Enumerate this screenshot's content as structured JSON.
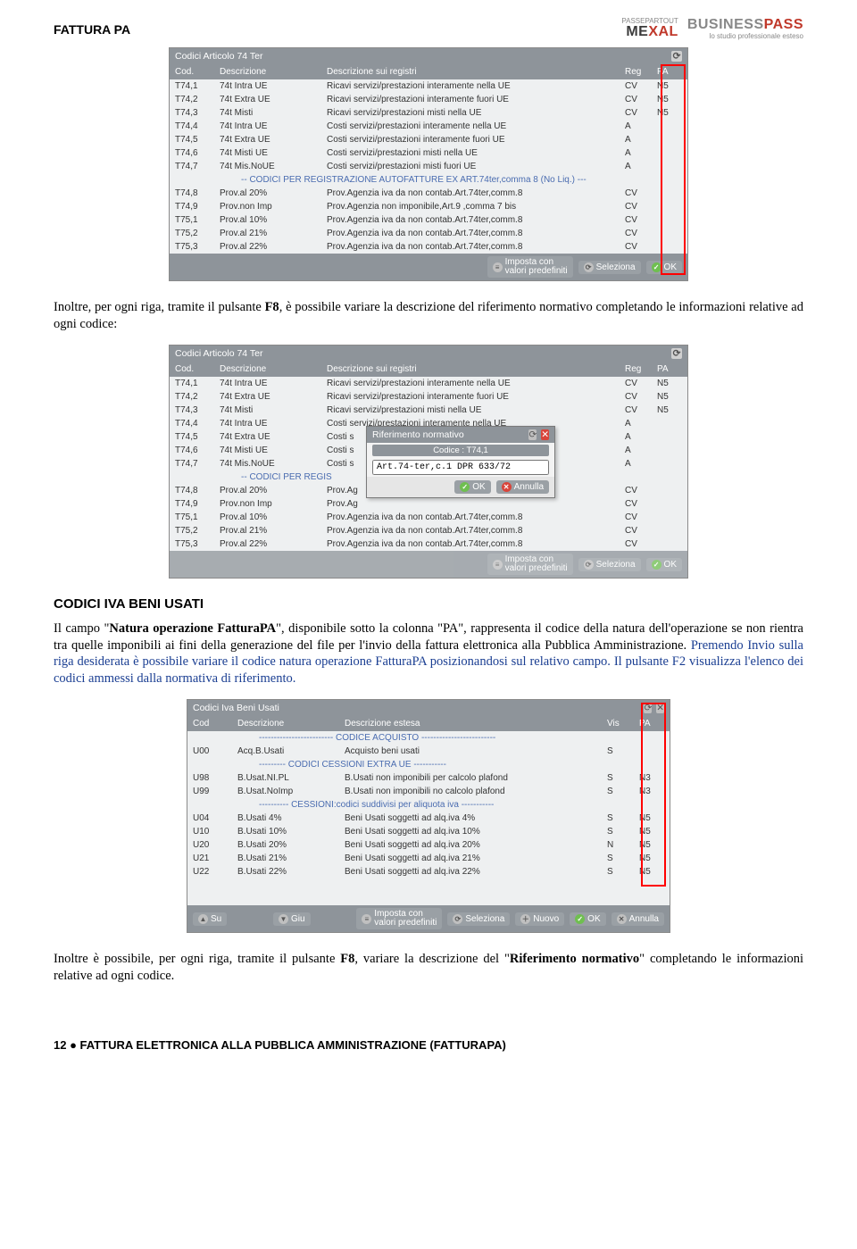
{
  "header": {
    "title": "FATTURA PA",
    "logo1_top": "PASSEPARTOUT",
    "logo1_brand_l": "ME",
    "logo1_brand_r": "XAL",
    "logo2_brand_l": "BUSINESS",
    "logo2_brand_r": "PASS",
    "logo2_sub": "lo studio professionale esteso"
  },
  "table1": {
    "title": "Codici Articolo 74 Ter",
    "h_cod": "Cod.",
    "h_desc": "Descrizione",
    "h_descsu": "Descrizione sui registri",
    "h_reg": "Reg",
    "h_pa": "PA",
    "rows": [
      {
        "cod": "T74,1",
        "desc": "74t Intra UE",
        "descsu": "Ricavi servizi/prestazioni interamente nella UE",
        "reg": "CV",
        "pa": "N5"
      },
      {
        "cod": "T74,2",
        "desc": "74t Extra UE",
        "descsu": "Ricavi servizi/prestazioni interamente fuori UE",
        "reg": "CV",
        "pa": "N5"
      },
      {
        "cod": "T74,3",
        "desc": "74t Misti",
        "descsu": "Ricavi servizi/prestazioni misti nella UE",
        "reg": "CV",
        "pa": "N5"
      },
      {
        "cod": "T74,4",
        "desc": "74t Intra UE",
        "descsu": "Costi  servizi/prestazioni interamente nella UE",
        "reg": "A",
        "pa": ""
      },
      {
        "cod": "T74,5",
        "desc": "74t Extra UE",
        "descsu": "Costi  servizi/prestazioni interamente fuori UE",
        "reg": "A",
        "pa": ""
      },
      {
        "cod": "T74,6",
        "desc": "74t Misti UE",
        "descsu": "Costi  servizi/prestazioni misti nella UE",
        "reg": "A",
        "pa": ""
      },
      {
        "cod": "T74,7",
        "desc": "74t Mis.NoUE",
        "descsu": "Costi  servizi/prestazioni misti fuori UE",
        "reg": "A",
        "pa": ""
      },
      {
        "section": "-- CODICI PER REGISTRAZIONE AUTOFATTURE EX ART.74ter,comma 8 (No Liq.) ---"
      },
      {
        "cod": "T74,8",
        "desc": "Prov.al 20%",
        "descsu": "Prov.Agenzia iva da non contab.Art.74ter,comm.8",
        "reg": "CV",
        "pa": ""
      },
      {
        "cod": "T74,9",
        "desc": "Prov.non Imp",
        "descsu": "Prov.Agenzia non imponibile,Art.9 ,comma 7 bis",
        "reg": "CV",
        "pa": ""
      },
      {
        "cod": "T75,1",
        "desc": "Prov.al 10%",
        "descsu": "Prov.Agenzia iva da non contab.Art.74ter,comm.8",
        "reg": "CV",
        "pa": ""
      },
      {
        "cod": "T75,2",
        "desc": "Prov.al 21%",
        "descsu": "Prov.Agenzia iva da non contab.Art.74ter,comm.8",
        "reg": "CV",
        "pa": ""
      },
      {
        "cod": "T75,3",
        "desc": "Prov.al 22%",
        "descsu": "Prov.Agenzia iva da non contab.Art.74ter,comm.8",
        "reg": "CV",
        "pa": ""
      }
    ],
    "footer": {
      "imposta_l1": "Imposta con",
      "imposta_l2": "valori predefiniti",
      "seleziona": "Seleziona",
      "ok": "OK"
    }
  },
  "para1": "Inoltre, per ogni riga, tramite il pulsante F8, è possibile variare la descrizione del riferimento normativo completando le informazioni relative ad ogni codice:",
  "para1_bold": "F8",
  "section2_title": "CODICI IVA BENI USATI",
  "para2_parts": {
    "t1": "Il campo \"",
    "b1": "Natura operazione FatturaPA",
    "t2": "\", disponibile sotto la colonna \"PA\", rappresenta il codice della natura dell'operazione se non rientra tra quelle imponibili ai fini della generazione del file per l'invio della fattura elettronica alla Pubblica Amministrazione.",
    "pa_span": " Premendo Invio sulla riga desiderata è possibile variare il codice natura operazione FatturaPA posizionandosi sul relativo campo. Il pulsante F2 visualizza l'elenco dei codici ammessi dalla normativa di riferimento."
  },
  "modal": {
    "title": "Riferimento normativo",
    "codice_label": "Codice :  T74,1",
    "value": "Art.74-ter,c.1 DPR 633/72",
    "ok": "OK",
    "annulla": "Annulla"
  },
  "table2": {
    "title": "Codici Articolo 74 Ter",
    "section_text": "-- CODICI PER REGIS"
  },
  "table3": {
    "title": "Codici Iva Beni Usati",
    "h_cod": "Cod",
    "h_desc": "Descrizione",
    "h_est": "Descrizione estesa",
    "h_vis": "Vis",
    "h_pa": "PA",
    "rows": [
      {
        "section": "------------------------- CODICE ACQUISTO -------------------------"
      },
      {
        "cod": "U00",
        "desc": "Acq.B.Usati",
        "est": "Acquisto beni usati",
        "vis": "S",
        "pa": ""
      },
      {
        "section": "--------- CODICI CESSIONI EXTRA UE -----------"
      },
      {
        "cod": "U98",
        "desc": "B.Usat.NI.PL",
        "est": "B.Usati non imponibili per calcolo plafond",
        "vis": "S",
        "pa": "N3"
      },
      {
        "cod": "U99",
        "desc": "B.Usat.NoImp",
        "est": "B.Usati non imponibili no calcolo plafond",
        "vis": "S",
        "pa": "N3"
      },
      {
        "section": "---------- CESSIONI:codici suddivisi per aliquota iva -----------"
      },
      {
        "cod": "U04",
        "desc": "B.Usati  4%",
        "est": "Beni Usati soggetti ad alq.iva  4%",
        "vis": "S",
        "pa": "N5"
      },
      {
        "cod": "U10",
        "desc": "B.Usati 10%",
        "est": "Beni Usati soggetti ad alq.iva 10%",
        "vis": "S",
        "pa": "N5"
      },
      {
        "cod": "U20",
        "desc": "B.Usati 20%",
        "est": "Beni Usati soggetti ad alq.iva 20%",
        "vis": "N",
        "pa": "N5"
      },
      {
        "cod": "U21",
        "desc": "B.Usati 21%",
        "est": "Beni Usati soggetti ad alq.iva 21%",
        "vis": "S",
        "pa": "N5"
      },
      {
        "cod": "U22",
        "desc": "B.Usati 22%",
        "est": "Beni Usati soggetti ad alq.iva 22%",
        "vis": "S",
        "pa": "N5"
      }
    ],
    "footer": {
      "su": "Su",
      "giu": "Giu",
      "imposta_l1": "Imposta con",
      "imposta_l2": "valori predefiniti",
      "seleziona": "Seleziona",
      "nuovo": "Nuovo",
      "ok": "OK",
      "annulla": "Annulla"
    }
  },
  "para3_parts": {
    "t1": "Inoltre è possibile, per ogni riga, tramite il pulsante ",
    "b1": "F8",
    "t2": ", variare la descrizione del \"",
    "b2": "Riferimento normativo",
    "t3": "\" completando le informazioni relative ad ogni codice."
  },
  "footer_line": "12  ●  FATTURA ELETTRONICA ALLA PUBBLICA AMMINISTRAZIONE (FATTURAPA)"
}
